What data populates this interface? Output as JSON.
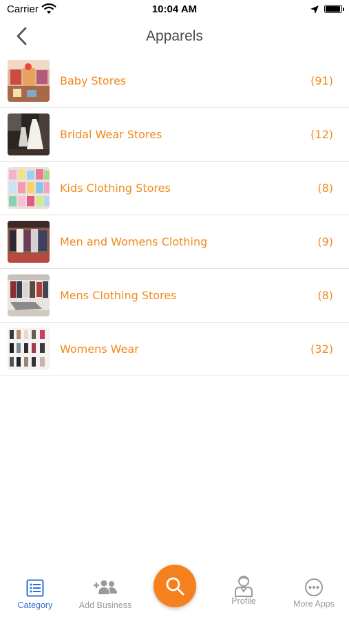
{
  "status_bar": {
    "carrier": "Carrier",
    "time": "10:04 AM"
  },
  "header": {
    "title": "Apparels"
  },
  "categories": [
    {
      "name": "Baby Stores",
      "count": "(91)"
    },
    {
      "name": "Bridal Wear Stores",
      "count": "(12)"
    },
    {
      "name": "Kids Clothing Stores",
      "count": "(8)"
    },
    {
      "name": "Men and Womens Clothing",
      "count": "(9)"
    },
    {
      "name": "Mens Clothing Stores",
      "count": "(8)"
    },
    {
      "name": "Womens Wear",
      "count": "(32)"
    }
  ],
  "tabbar": {
    "category": "Category",
    "add_business": "Add Business",
    "profile": "Profile",
    "more_apps": "More Apps"
  },
  "colors": {
    "accent": "#f08a1c",
    "fab": "#f7801e",
    "active_tab": "#2d6fd6",
    "inactive_tab": "#9a9a9a"
  },
  "icons": {
    "back": "chevron-left-icon",
    "search": "search-icon",
    "category": "list-icon",
    "add_business": "add-users-icon",
    "profile": "user-icon",
    "more_apps": "more-icon"
  }
}
